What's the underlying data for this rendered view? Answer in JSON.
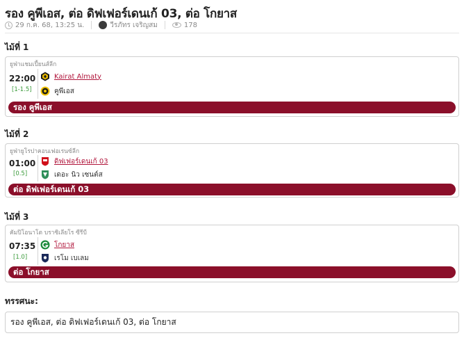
{
  "article": {
    "title": "รอง คูพีเอส, ต่อ ดิฟเฟอร์เดนเก้ 03, ต่อ โกยาส",
    "date": "29 ก.ค. 68, 13:25 น.",
    "author": "วีรภัทร เจริญสม",
    "views": "178"
  },
  "matches": [
    {
      "pair_label": "ไม้ที่ 1",
      "league": "ยูฟ่าแชมเปี้ยนส์ลีก",
      "time": "22:00",
      "handicap": "[1-1.5]",
      "home": "Kairat Almaty",
      "away": "คูพีเอส",
      "tip": "รอง คูพีเอส",
      "home_logo_icon": "kairat-almaty-logo-icon",
      "away_logo_icon": "kups-logo-icon"
    },
    {
      "pair_label": "ไม้ที่ 2",
      "league": "ยูฟ่ายูโรปาคอนเฟอเรนซ์ลีก",
      "time": "01:00",
      "handicap": "[0.5]",
      "home": "ดิฟเฟอร์เดนเก้ 03",
      "away": "เดอะ นิว เซนต์ส",
      "tip": "ต่อ ดิฟเฟอร์เดนเก้ 03",
      "home_logo_icon": "differdange-logo-icon",
      "away_logo_icon": "the-new-saints-logo-icon"
    },
    {
      "pair_label": "ไม้ที่ 3",
      "league": "คัมปิโอนาโต บราซิเลียโร ซีรีบี",
      "time": "07:35",
      "handicap": "[1.0]",
      "home": "โกยาส",
      "away": "เรโม เบเลม",
      "tip": "ต่อ โกยาส",
      "home_logo_icon": "goias-logo-icon",
      "away_logo_icon": "remo-logo-icon"
    }
  ],
  "summary": {
    "label": "ทรรศนะ:",
    "text": "รอง คูพีเอส, ต่อ ดิฟเฟอร์เดนเก้ 03, ต่อ โกยาส"
  },
  "colors": {
    "tip_bar": "#8b0f2a",
    "favorite_link": "#b0143a",
    "handicap": "#3a9a3a"
  }
}
